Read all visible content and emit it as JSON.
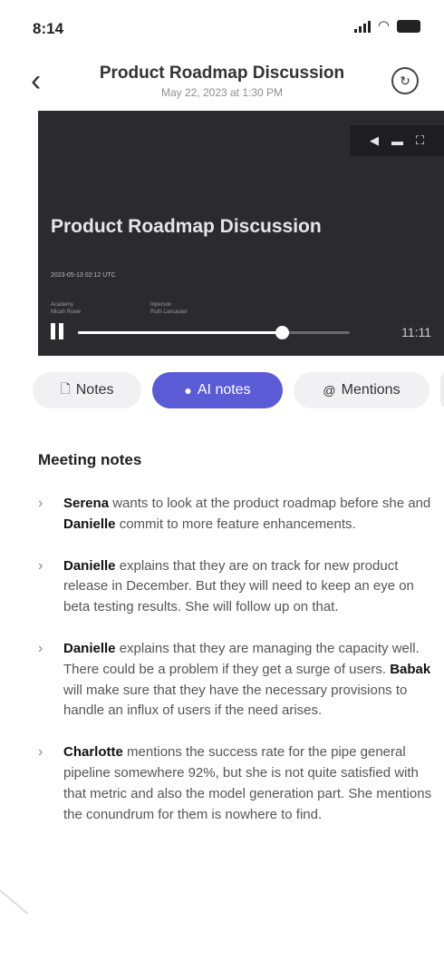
{
  "status": {
    "time": "8:14"
  },
  "header": {
    "title": "Product Roadmap Discussion",
    "subtitle": "May 22, 2023 at 1:30 PM"
  },
  "video": {
    "title": "Product Roadmap Discussion",
    "date_small": "2023-05-13 02:12 UTC",
    "meta_a_label": "Academy",
    "meta_a_value": "Micah Rowe",
    "meta_b_label": "Inperson",
    "meta_b_value": "Ruth Lancaster",
    "progress": 0.75,
    "duration": "11:11",
    "control_icons": [
      "volume-icon",
      "captions-icon",
      "fullscreen-icon"
    ]
  },
  "tabs": [
    {
      "label": "Notes",
      "icon": "notes-icon",
      "active": false
    },
    {
      "label": "AI notes",
      "icon": "lightbulb-icon",
      "active": true
    },
    {
      "label": "Mentions",
      "icon": "at-icon",
      "active": false
    }
  ],
  "section_title": "Meeting notes",
  "notes": [
    [
      {
        "b": "Serena"
      },
      {
        "t": " wants to look at the product roadmap before she and "
      },
      {
        "b": "Danielle"
      },
      {
        "t": " commit to more feature enhancements."
      }
    ],
    [
      {
        "b": "Danielle"
      },
      {
        "t": " explains that they are on track for new product release in December. But they will need to keep an eye on beta testing results. She will follow up on that."
      }
    ],
    [
      {
        "b": "Danielle"
      },
      {
        "t": " explains that they are managing the capacity well. There could be a problem if they get a surge of users. "
      },
      {
        "b": "Babak"
      },
      {
        "t": " will make sure that they have the necessary provisions to handle an influx of users if the need arises."
      }
    ],
    [
      {
        "b": "Charlotte"
      },
      {
        "t": " mentions the success rate for the pipe general pipeline somewhere 92%, but she is not quite satisfied with that metric and also the model generation part. She mentions the conundrum for them is nowhere to find."
      }
    ]
  ],
  "colors": {
    "accent": "#5b5bd6",
    "video_bg": "#2b2b2f"
  }
}
